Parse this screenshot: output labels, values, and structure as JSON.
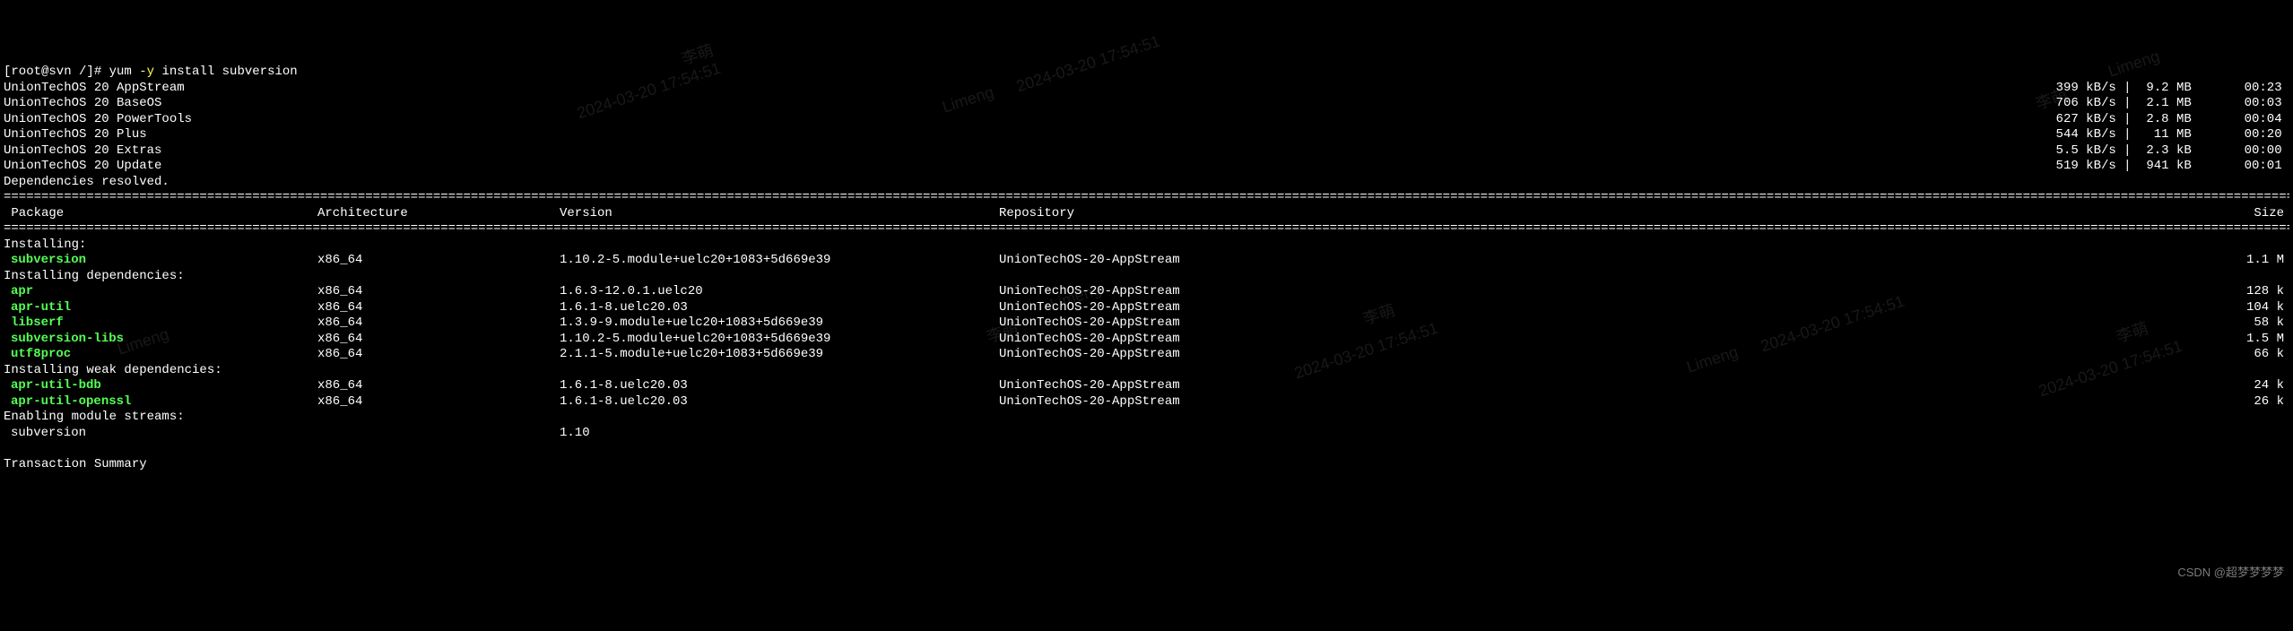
{
  "prompt": "[root@svn /]# ",
  "command": "yum -y install subversion",
  "repos": [
    {
      "name": "UnionTechOS 20 AppStream",
      "speed": "399 kB/s",
      "size": "9.2 MB",
      "time": "00:23"
    },
    {
      "name": "UnionTechOS 20 BaseOS",
      "speed": "706 kB/s",
      "size": "2.1 MB",
      "time": "00:03"
    },
    {
      "name": "UnionTechOS 20 PowerTools",
      "speed": "627 kB/s",
      "size": "2.8 MB",
      "time": "00:04"
    },
    {
      "name": "UnionTechOS 20 Plus",
      "speed": "544 kB/s",
      "size": " 11 MB",
      "time": "00:20"
    },
    {
      "name": "UnionTechOS 20 Extras",
      "speed": "5.5 kB/s",
      "size": "2.3 kB",
      "time": "00:00"
    },
    {
      "name": "UnionTechOS 20 Update",
      "speed": "519 kB/s",
      "size": "941 kB",
      "time": "00:01"
    }
  ],
  "deps_resolved": "Dependencies resolved.",
  "headers": {
    "pkg": "Package",
    "arch": "Architecture",
    "ver": "Version",
    "repo": "Repository",
    "size": "Size"
  },
  "sections": {
    "installing": "Installing:",
    "installing_deps": "Installing dependencies:",
    "installing_weak": "Installing weak dependencies:",
    "enabling_modules": "Enabling module streams:"
  },
  "packages": {
    "main": [
      {
        "name": "subversion",
        "arch": "x86_64",
        "ver": "1.10.2-5.module+uelc20+1083+5d669e39",
        "repo": "UnionTechOS-20-AppStream",
        "size": "1.1 M"
      }
    ],
    "deps": [
      {
        "name": "apr",
        "arch": "x86_64",
        "ver": "1.6.3-12.0.1.uelc20",
        "repo": "UnionTechOS-20-AppStream",
        "size": "128 k"
      },
      {
        "name": "apr-util",
        "arch": "x86_64",
        "ver": "1.6.1-8.uelc20.03",
        "repo": "UnionTechOS-20-AppStream",
        "size": "104 k"
      },
      {
        "name": "libserf",
        "arch": "x86_64",
        "ver": "1.3.9-9.module+uelc20+1083+5d669e39",
        "repo": "UnionTechOS-20-AppStream",
        "size": "58 k"
      },
      {
        "name": "subversion-libs",
        "arch": "x86_64",
        "ver": "1.10.2-5.module+uelc20+1083+5d669e39",
        "repo": "UnionTechOS-20-AppStream",
        "size": "1.5 M"
      },
      {
        "name": "utf8proc",
        "arch": "x86_64",
        "ver": "2.1.1-5.module+uelc20+1083+5d669e39",
        "repo": "UnionTechOS-20-AppStream",
        "size": "66 k"
      }
    ],
    "weak": [
      {
        "name": "apr-util-bdb",
        "arch": "x86_64",
        "ver": "1.6.1-8.uelc20.03",
        "repo": "UnionTechOS-20-AppStream",
        "size": "24 k"
      },
      {
        "name": "apr-util-openssl",
        "arch": "x86_64",
        "ver": "1.6.1-8.uelc20.03",
        "repo": "UnionTechOS-20-AppStream",
        "size": "26 k"
      }
    ],
    "modules": [
      {
        "name": "subversion",
        "arch": "",
        "ver": "1.10",
        "repo": "",
        "size": ""
      }
    ]
  },
  "txn_summary": "Transaction Summary",
  "divider_char": "=",
  "watermark": {
    "text1": "Limeng",
    "text2": "李萌",
    "text3": "2024-03-20 17:54:51"
  },
  "csdn": "CSDN @超梦梦梦梦"
}
